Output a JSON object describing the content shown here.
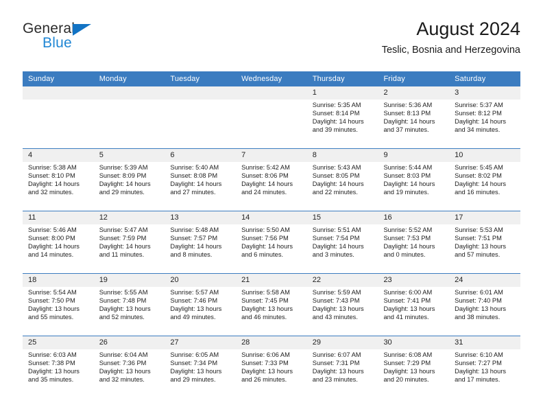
{
  "brand": {
    "name_part1": "General",
    "name_part2": "Blue",
    "triangle_color": "#1273c4",
    "blue_color": "#1f86d4"
  },
  "header": {
    "title": "August 2024",
    "subtitle": "Teslic, Bosnia and Herzegovina"
  },
  "theme": {
    "header_blue": "#3b7cc0",
    "daynum_bg": "#f0f0f0",
    "text": "#1c1c1c"
  },
  "weekday_headers": [
    "Sunday",
    "Monday",
    "Tuesday",
    "Wednesday",
    "Thursday",
    "Friday",
    "Saturday"
  ],
  "weeks": [
    {
      "days": [
        {
          "num": "",
          "sunrise": "",
          "sunset": "",
          "daylight1": "",
          "daylight2": ""
        },
        {
          "num": "",
          "sunrise": "",
          "sunset": "",
          "daylight1": "",
          "daylight2": ""
        },
        {
          "num": "",
          "sunrise": "",
          "sunset": "",
          "daylight1": "",
          "daylight2": ""
        },
        {
          "num": "",
          "sunrise": "",
          "sunset": "",
          "daylight1": "",
          "daylight2": ""
        },
        {
          "num": "1",
          "sunrise": "Sunrise: 5:35 AM",
          "sunset": "Sunset: 8:14 PM",
          "daylight1": "Daylight: 14 hours",
          "daylight2": "and 39 minutes."
        },
        {
          "num": "2",
          "sunrise": "Sunrise: 5:36 AM",
          "sunset": "Sunset: 8:13 PM",
          "daylight1": "Daylight: 14 hours",
          "daylight2": "and 37 minutes."
        },
        {
          "num": "3",
          "sunrise": "Sunrise: 5:37 AM",
          "sunset": "Sunset: 8:12 PM",
          "daylight1": "Daylight: 14 hours",
          "daylight2": "and 34 minutes."
        }
      ]
    },
    {
      "days": [
        {
          "num": "4",
          "sunrise": "Sunrise: 5:38 AM",
          "sunset": "Sunset: 8:10 PM",
          "daylight1": "Daylight: 14 hours",
          "daylight2": "and 32 minutes."
        },
        {
          "num": "5",
          "sunrise": "Sunrise: 5:39 AM",
          "sunset": "Sunset: 8:09 PM",
          "daylight1": "Daylight: 14 hours",
          "daylight2": "and 29 minutes."
        },
        {
          "num": "6",
          "sunrise": "Sunrise: 5:40 AM",
          "sunset": "Sunset: 8:08 PM",
          "daylight1": "Daylight: 14 hours",
          "daylight2": "and 27 minutes."
        },
        {
          "num": "7",
          "sunrise": "Sunrise: 5:42 AM",
          "sunset": "Sunset: 8:06 PM",
          "daylight1": "Daylight: 14 hours",
          "daylight2": "and 24 minutes."
        },
        {
          "num": "8",
          "sunrise": "Sunrise: 5:43 AM",
          "sunset": "Sunset: 8:05 PM",
          "daylight1": "Daylight: 14 hours",
          "daylight2": "and 22 minutes."
        },
        {
          "num": "9",
          "sunrise": "Sunrise: 5:44 AM",
          "sunset": "Sunset: 8:03 PM",
          "daylight1": "Daylight: 14 hours",
          "daylight2": "and 19 minutes."
        },
        {
          "num": "10",
          "sunrise": "Sunrise: 5:45 AM",
          "sunset": "Sunset: 8:02 PM",
          "daylight1": "Daylight: 14 hours",
          "daylight2": "and 16 minutes."
        }
      ]
    },
    {
      "days": [
        {
          "num": "11",
          "sunrise": "Sunrise: 5:46 AM",
          "sunset": "Sunset: 8:00 PM",
          "daylight1": "Daylight: 14 hours",
          "daylight2": "and 14 minutes."
        },
        {
          "num": "12",
          "sunrise": "Sunrise: 5:47 AM",
          "sunset": "Sunset: 7:59 PM",
          "daylight1": "Daylight: 14 hours",
          "daylight2": "and 11 minutes."
        },
        {
          "num": "13",
          "sunrise": "Sunrise: 5:48 AM",
          "sunset": "Sunset: 7:57 PM",
          "daylight1": "Daylight: 14 hours",
          "daylight2": "and 8 minutes."
        },
        {
          "num": "14",
          "sunrise": "Sunrise: 5:50 AM",
          "sunset": "Sunset: 7:56 PM",
          "daylight1": "Daylight: 14 hours",
          "daylight2": "and 6 minutes."
        },
        {
          "num": "15",
          "sunrise": "Sunrise: 5:51 AM",
          "sunset": "Sunset: 7:54 PM",
          "daylight1": "Daylight: 14 hours",
          "daylight2": "and 3 minutes."
        },
        {
          "num": "16",
          "sunrise": "Sunrise: 5:52 AM",
          "sunset": "Sunset: 7:53 PM",
          "daylight1": "Daylight: 14 hours",
          "daylight2": "and 0 minutes."
        },
        {
          "num": "17",
          "sunrise": "Sunrise: 5:53 AM",
          "sunset": "Sunset: 7:51 PM",
          "daylight1": "Daylight: 13 hours",
          "daylight2": "and 57 minutes."
        }
      ]
    },
    {
      "days": [
        {
          "num": "18",
          "sunrise": "Sunrise: 5:54 AM",
          "sunset": "Sunset: 7:50 PM",
          "daylight1": "Daylight: 13 hours",
          "daylight2": "and 55 minutes."
        },
        {
          "num": "19",
          "sunrise": "Sunrise: 5:55 AM",
          "sunset": "Sunset: 7:48 PM",
          "daylight1": "Daylight: 13 hours",
          "daylight2": "and 52 minutes."
        },
        {
          "num": "20",
          "sunrise": "Sunrise: 5:57 AM",
          "sunset": "Sunset: 7:46 PM",
          "daylight1": "Daylight: 13 hours",
          "daylight2": "and 49 minutes."
        },
        {
          "num": "21",
          "sunrise": "Sunrise: 5:58 AM",
          "sunset": "Sunset: 7:45 PM",
          "daylight1": "Daylight: 13 hours",
          "daylight2": "and 46 minutes."
        },
        {
          "num": "22",
          "sunrise": "Sunrise: 5:59 AM",
          "sunset": "Sunset: 7:43 PM",
          "daylight1": "Daylight: 13 hours",
          "daylight2": "and 43 minutes."
        },
        {
          "num": "23",
          "sunrise": "Sunrise: 6:00 AM",
          "sunset": "Sunset: 7:41 PM",
          "daylight1": "Daylight: 13 hours",
          "daylight2": "and 41 minutes."
        },
        {
          "num": "24",
          "sunrise": "Sunrise: 6:01 AM",
          "sunset": "Sunset: 7:40 PM",
          "daylight1": "Daylight: 13 hours",
          "daylight2": "and 38 minutes."
        }
      ]
    },
    {
      "days": [
        {
          "num": "25",
          "sunrise": "Sunrise: 6:03 AM",
          "sunset": "Sunset: 7:38 PM",
          "daylight1": "Daylight: 13 hours",
          "daylight2": "and 35 minutes."
        },
        {
          "num": "26",
          "sunrise": "Sunrise: 6:04 AM",
          "sunset": "Sunset: 7:36 PM",
          "daylight1": "Daylight: 13 hours",
          "daylight2": "and 32 minutes."
        },
        {
          "num": "27",
          "sunrise": "Sunrise: 6:05 AM",
          "sunset": "Sunset: 7:34 PM",
          "daylight1": "Daylight: 13 hours",
          "daylight2": "and 29 minutes."
        },
        {
          "num": "28",
          "sunrise": "Sunrise: 6:06 AM",
          "sunset": "Sunset: 7:33 PM",
          "daylight1": "Daylight: 13 hours",
          "daylight2": "and 26 minutes."
        },
        {
          "num": "29",
          "sunrise": "Sunrise: 6:07 AM",
          "sunset": "Sunset: 7:31 PM",
          "daylight1": "Daylight: 13 hours",
          "daylight2": "and 23 minutes."
        },
        {
          "num": "30",
          "sunrise": "Sunrise: 6:08 AM",
          "sunset": "Sunset: 7:29 PM",
          "daylight1": "Daylight: 13 hours",
          "daylight2": "and 20 minutes."
        },
        {
          "num": "31",
          "sunrise": "Sunrise: 6:10 AM",
          "sunset": "Sunset: 7:27 PM",
          "daylight1": "Daylight: 13 hours",
          "daylight2": "and 17 minutes."
        }
      ]
    }
  ]
}
